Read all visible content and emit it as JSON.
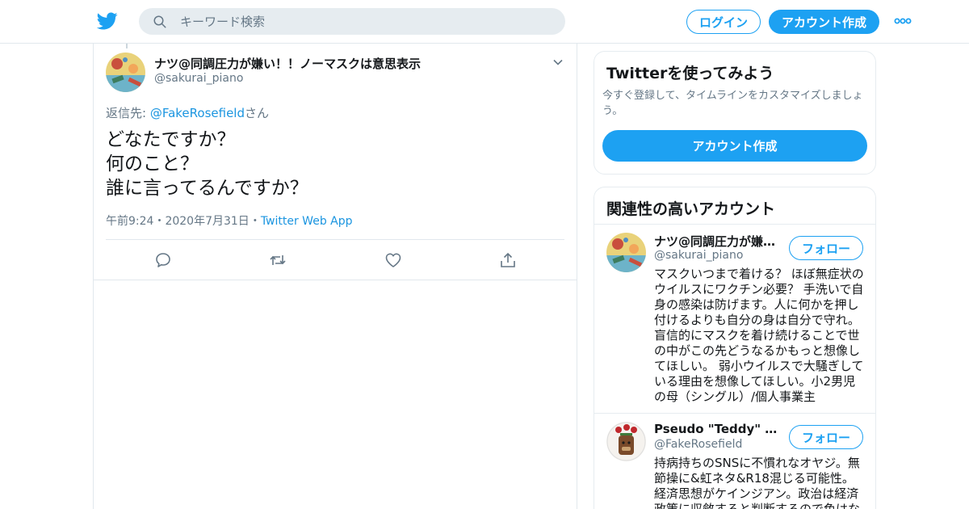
{
  "header": {
    "logo_icon": "twitter-bird-icon",
    "search_placeholder": "キーワード検索",
    "login_label": "ログイン",
    "signup_label": "アカウント作成",
    "more_icon": "more-dots-icon",
    "accent_color": "#1da1f2"
  },
  "tweet": {
    "author_name": "ナツ@同調圧力が嫌い！！ノーマスクは意思表示",
    "author_handle": "@sakurai_piano",
    "reply_prefix": "返信先: ",
    "reply_handle": "@FakeRosefield",
    "reply_suffix": "さん",
    "lines": [
      "どなたですか？",
      "何のこと？",
      "誰に言ってるんですか？"
    ],
    "time": "午前9:24",
    "sep1": "・",
    "date": "2020年7月31日",
    "sep2": "・",
    "app": "Twitter Web App",
    "actions": [
      "reply-icon",
      "retweet-icon",
      "like-icon",
      "share-icon"
    ]
  },
  "sidebar": {
    "signup_card": {
      "title": "Twitterを使ってみよう",
      "description": "今すぐ登録して、タイムラインをカスタマイズしましょう。",
      "button": "アカウント作成"
    },
    "related": {
      "title": "関連性の高いアカウント",
      "accounts": [
        {
          "name": "ナツ@同調圧力が嫌い！！ノーマスクは意思表示",
          "handle": "@sakurai_piano",
          "follow": "フォロー",
          "bio": "マスクいつまで着ける？ ほぼ無症状のウイルスにワクチン必要？ 手洗いで自身の感染は防げます。人に何かを押し付けるよりも自分の身は自分で守れ。 盲信的にマスクを着け続けることで世の中がこの先どうなるかもっと想像してほしい。 弱小ウイルスで大騒ぎしている理由を想像してほしい。小2男児の母（シングル）/個人事業主"
        },
        {
          "name": "Pseudo \"Teddy\" Rosefield",
          "handle": "@FakeRosefield",
          "follow": "フォロー",
          "bio": "持病持ちのSNSに不慣れなオヤジ。無節操に&虹ネタ&R18混じる可能性。経済思想がケインジアン。政治は経済政策に収斂すると判断するので色はない"
        }
      ]
    }
  }
}
